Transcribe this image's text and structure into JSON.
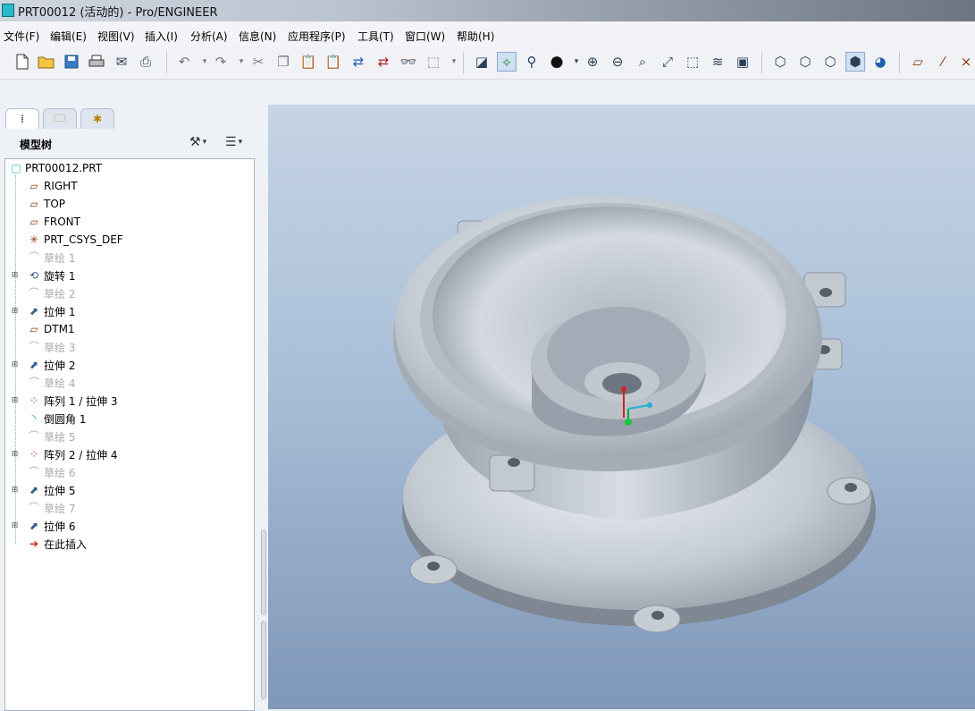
{
  "window": {
    "title": "PRT00012 (活动的) - Pro/ENGINEER"
  },
  "menu": [
    "文件(F)",
    "编辑(E)",
    "视图(V)",
    "插入(I)",
    "分析(A)",
    "信息(N)",
    "应用程序(P)",
    "工具(T)",
    "窗口(W)",
    "帮助(H)"
  ],
  "model_tree": {
    "title": "模型树",
    "root": "PRT00012.PRT",
    "items": [
      {
        "label": "RIGHT",
        "icon": "datum-plane-icon"
      },
      {
        "label": "TOP",
        "icon": "datum-plane-icon"
      },
      {
        "label": "FRONT",
        "icon": "datum-plane-icon"
      },
      {
        "label": "PRT_CSYS_DEF",
        "icon": "coordinate-system-icon"
      },
      {
        "label": "草绘 1",
        "icon": "sketch-icon",
        "dim": true
      },
      {
        "label": "旋转 1",
        "icon": "revolve-icon",
        "expandable": true
      },
      {
        "label": "草绘 2",
        "icon": "sketch-icon",
        "dim": true
      },
      {
        "label": "拉伸 1",
        "icon": "extrude-icon",
        "expandable": true
      },
      {
        "label": "DTM1",
        "icon": "datum-plane-icon"
      },
      {
        "label": "草绘 3",
        "icon": "sketch-icon",
        "dim": true
      },
      {
        "label": "拉伸 2",
        "icon": "extrude-icon",
        "expandable": true
      },
      {
        "label": "草绘 4",
        "icon": "sketch-icon",
        "dim": true
      },
      {
        "label": "阵列 1 / 拉伸 3",
        "icon": "pattern-icon",
        "expandable": true
      },
      {
        "label": "倒圆角 1",
        "icon": "round-icon"
      },
      {
        "label": "草绘 5",
        "icon": "sketch-icon",
        "dim": true
      },
      {
        "label": "阵列 2 / 拉伸 4",
        "icon": "pattern-icon",
        "expandable": true
      },
      {
        "label": "草绘 6",
        "icon": "sketch-icon",
        "dim": true
      },
      {
        "label": "拉伸 5",
        "icon": "extrude-icon",
        "expandable": true
      },
      {
        "label": "草绘 7",
        "icon": "sketch-icon",
        "dim": true
      },
      {
        "label": "拉伸 6",
        "icon": "extrude-icon",
        "expandable": true
      },
      {
        "label": "在此插入",
        "icon": "insert-here-arrow-icon"
      }
    ]
  }
}
